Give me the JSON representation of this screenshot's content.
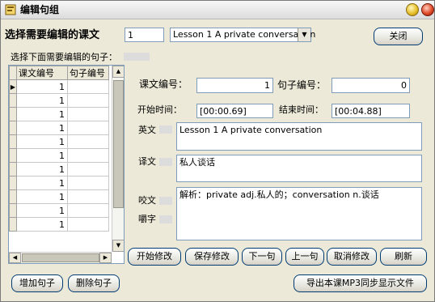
{
  "window": {
    "title": "编辑句组"
  },
  "header": {
    "select_lesson_label": "选择需要编辑的课文",
    "lesson_number_value": "1",
    "lesson_selected": "Lesson 1 A private conversation",
    "close_label": "关闭"
  },
  "grid": {
    "caption": "选择下面需要编辑的句子：",
    "columns": [
      "课文编号",
      "句子编号"
    ],
    "rows": [
      "1",
      "1",
      "1",
      "1",
      "1",
      "1",
      "1",
      "1",
      "1",
      "1",
      "1"
    ]
  },
  "form": {
    "lesson_no_label": "课文编号：",
    "lesson_no_value": "1",
    "sentence_no_label": "句子编号：",
    "sentence_no_value": "0",
    "start_label": "开始时间：",
    "start_value": "[00:00.69]",
    "end_label": "结束时间：",
    "end_value": "[00:04.88]",
    "english_label": "英文",
    "english_value": "Lesson 1 A private conversation",
    "translation_label": "译文",
    "translation_value": "私人谈话",
    "pron_label": "咬文",
    "chew_label": "嚼字",
    "notes_value": "解析：private  adj.私人的；conversation  n.谈话"
  },
  "buttons": {
    "start_edit": "开始修改",
    "save_edit": "保存修改",
    "next": "下一句",
    "prev": "上一句",
    "cancel_edit": "取消修改",
    "refresh": "刷新",
    "add_sentence": "增加句子",
    "delete_sentence": "删除句子",
    "export": "导出本课MP3同步显示文件"
  }
}
